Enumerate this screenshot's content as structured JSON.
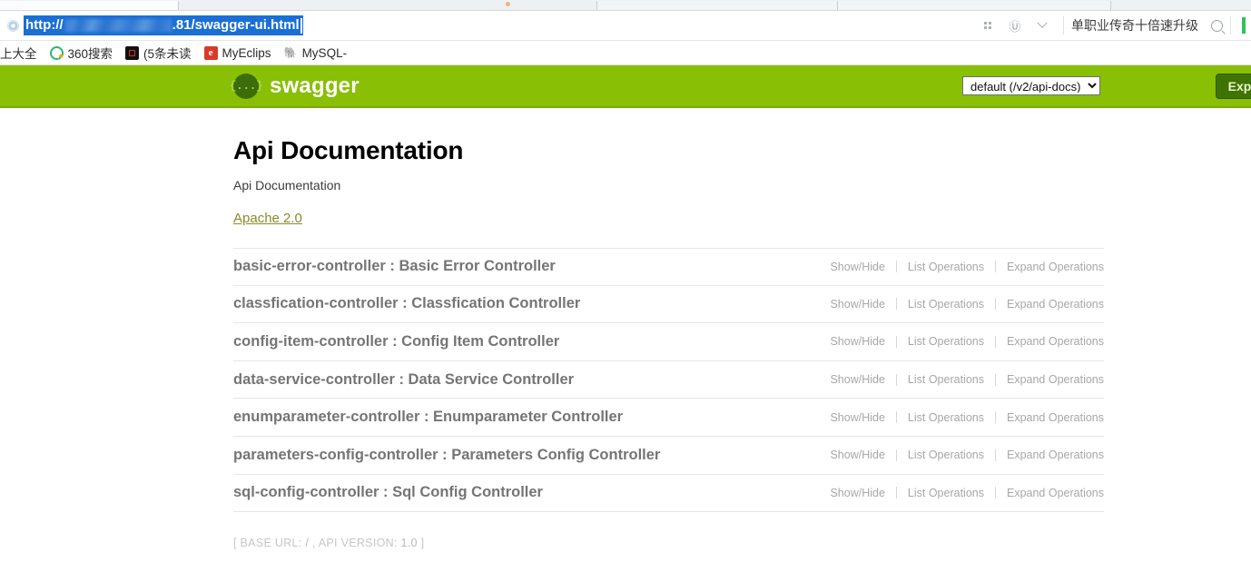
{
  "browser": {
    "url": {
      "scheme_host_prefix": "http://",
      "redacted": true,
      "visible_suffix": ".81/swagger-ui.html",
      "full_visible_text": "http://████████.81/swagger-ui.html",
      "selected": true
    },
    "toolbar_icons": [
      "apps-grid-icon",
      "edge-browser-icon",
      "chevron-down-icon"
    ],
    "search": {
      "text": "单职业传奇十倍速升级",
      "icon": "search-icon"
    },
    "bookmarks": [
      {
        "label": "上大全",
        "icon": "bookmark-icon"
      },
      {
        "label": "360搜索",
        "icon": "360-search-icon"
      },
      {
        "label": "(5条未读",
        "icon": "mail-icon"
      },
      {
        "label": "MyEclips",
        "icon": "myeclipse-icon"
      },
      {
        "label": "MySQL-",
        "icon": "mysql-icon"
      }
    ]
  },
  "swagger_header": {
    "logo_glyph": "{...}",
    "logo_text": "swagger",
    "api_select": {
      "selected": "default (/v2/api-docs)",
      "options": [
        "default (/v2/api-docs)"
      ]
    },
    "explore_label": "Explore",
    "background_color": "#89bf04",
    "explore_color": "#3f7304"
  },
  "main": {
    "title": "Api Documentation",
    "subtitle": "Api Documentation",
    "license": "Apache 2.0",
    "license_color": "#8a8a2a",
    "op_labels": {
      "show_hide": "Show/Hide",
      "list_operations": "List Operations",
      "expand_operations": "Expand Operations"
    },
    "resources": [
      {
        "name": "basic-error-controller : Basic Error Controller"
      },
      {
        "name": "classfication-controller : Classfication Controller"
      },
      {
        "name": "config-item-controller : Config Item Controller"
      },
      {
        "name": "data-service-controller : Data Service Controller"
      },
      {
        "name": "enumparameter-controller : Enumparameter Controller"
      },
      {
        "name": "parameters-config-controller : Parameters Config Controller"
      },
      {
        "name": "sql-config-controller : Sql Config Controller"
      }
    ],
    "footer": {
      "base_url_label": "[ BASE URL:",
      "base_url_value": "/",
      "api_version_label": ", API VERSION:",
      "api_version_value": "1.0",
      "close": "]"
    }
  }
}
